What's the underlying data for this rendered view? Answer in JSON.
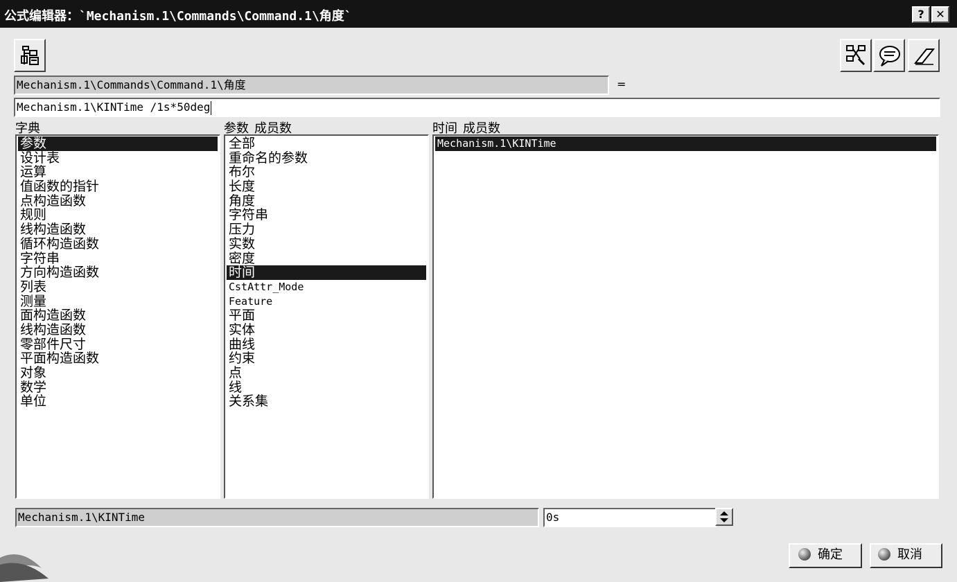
{
  "window": {
    "title": "公式编辑器：`Mechanism.1\\Commands\\Command.1\\角度`",
    "help_label": "?",
    "close_label": "✕"
  },
  "toolbar": {
    "left_icon": "formula-tree-icon",
    "right_icons": [
      "parameter-graph-icon",
      "comment-bubble-icon",
      "eraser-icon"
    ]
  },
  "formula": {
    "target_param": "Mechanism.1\\Commands\\Command.1\\角度",
    "equals": "=",
    "expression": "Mechanism.1\\KINTime /1s*50deg"
  },
  "dictionary": {
    "header": "字典",
    "items": [
      "参数",
      "设计表",
      "运算",
      "值函数的指针",
      "点构造函数",
      "规则",
      "线构造函数",
      "循环构造函数",
      "字符串",
      "方向构造函数",
      "列表",
      "测量",
      "面构造函数",
      "线构造函数",
      "零部件尺寸",
      "平面构造函数",
      "对象",
      "数学",
      "单位"
    ],
    "selected_index": 0
  },
  "parameters": {
    "header_a": "参数",
    "header_b": "成员数",
    "items": [
      "全部",
      "重命名的参数",
      "布尔",
      "长度",
      "角度",
      "字符串",
      "压力",
      "实数",
      "密度",
      "时间",
      "CstAttr_Mode",
      "Feature",
      "平面",
      "实体",
      "曲线",
      "约束",
      "点",
      "线",
      "关系集"
    ],
    "selected_index": 9
  },
  "members": {
    "header_a": "时间",
    "header_b": "成员数",
    "items": [
      "Mechanism.1\\KINTime"
    ],
    "selected_index": 0
  },
  "bottom": {
    "selected_param": "Mechanism.1\\KINTime",
    "value": "0s"
  },
  "buttons": {
    "ok": "确定",
    "cancel": "取消"
  }
}
